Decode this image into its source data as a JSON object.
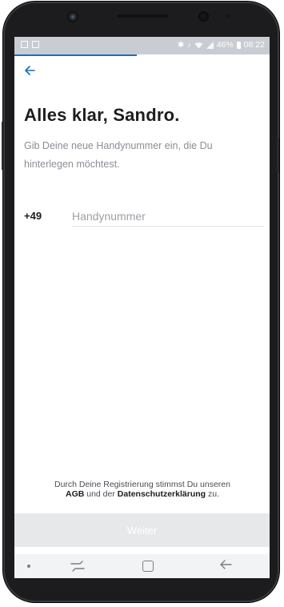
{
  "status_bar": {
    "battery": "46%",
    "time": "08:22",
    "left_icons": [
      "image-icon",
      "notification-icon"
    ],
    "right_icons": [
      "bluetooth-icon",
      "mute-icon",
      "wifi-icon",
      "signal-icon",
      "battery-icon"
    ]
  },
  "progress": {
    "fraction": 0.48,
    "color": "#1a6ec0"
  },
  "header": {
    "back_icon": "arrow-left-icon"
  },
  "main": {
    "title": "Alles klar, Sandro.",
    "subtitle": "Gib Deine neue Handynummer ein, die Du hinterlegen möchtest.",
    "country_code": "+49",
    "phone_placeholder": "Handynummer",
    "phone_value": ""
  },
  "legal": {
    "prefix": "Durch Deine Registrierung stimmst Du unseren",
    "agb": "AGB",
    "middle": "und der",
    "privacy": "Datenschutzerklärung",
    "suffix": "zu."
  },
  "footer": {
    "continue_label": "Weiter"
  },
  "nav_bar": {
    "items": [
      "dot-icon",
      "recent-apps-icon",
      "home-icon",
      "back-icon"
    ]
  },
  "colors": {
    "accent": "#1a6ec0",
    "title": "#1d1d1f",
    "muted": "#8b8e94",
    "button_disabled": "#e7e8ea"
  }
}
